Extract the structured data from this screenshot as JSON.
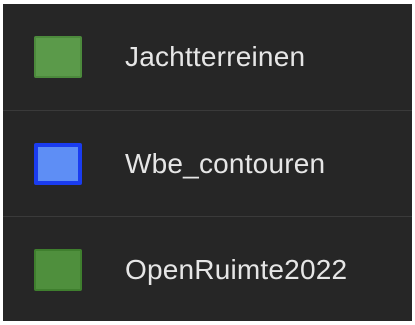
{
  "legend": {
    "items": [
      {
        "label": "Jachtterreinen",
        "fill": "#5b9a4a",
        "stroke": "#4c8a3c"
      },
      {
        "label": "Wbe_contouren",
        "fill": "#5e8ef5",
        "stroke": "#1a3cf0"
      },
      {
        "label": "OpenRuimte2022",
        "fill": "#4f8f3d",
        "stroke": "#3f7f2e"
      }
    ]
  }
}
